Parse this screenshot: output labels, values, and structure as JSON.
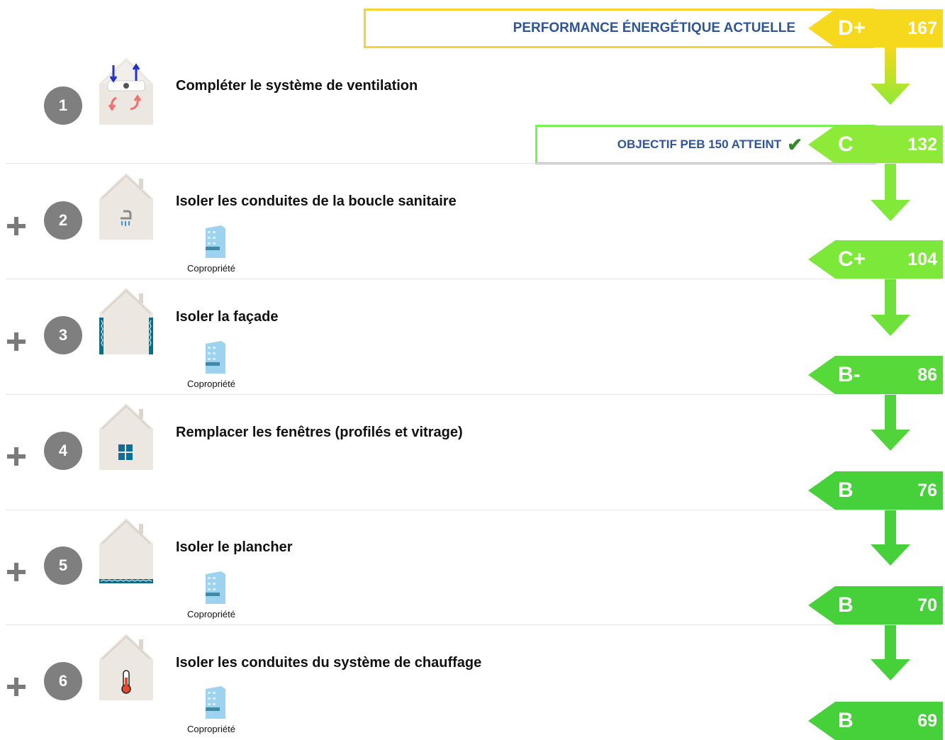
{
  "header": {
    "current_title": "PERFORMANCE ÉNERGÉTIQUE ACTUELLE",
    "target_title": "OBJECTIF PEB 150 ATTEINT",
    "target_check_icon": "checkmark-icon"
  },
  "colors": {
    "current_border": "#f5d330",
    "target_border": "#78f250",
    "title_blue": "#2f5597",
    "badge_grey": "#7f7f7f"
  },
  "labels": [
    {
      "class": "D+",
      "value": "167",
      "color": "#f6d81c"
    },
    {
      "class": "C",
      "value": "132",
      "color": "#8eea38"
    },
    {
      "class": "C+",
      "value": "104",
      "color": "#7ce83a"
    },
    {
      "class": "B-",
      "value": "86",
      "color": "#58d93a"
    },
    {
      "class": "B",
      "value": "76",
      "color": "#46d03a"
    },
    {
      "class": "B",
      "value": "70",
      "color": "#46d03a"
    },
    {
      "class": "B",
      "value": "69",
      "color": "#46d03a"
    }
  ],
  "steps": [
    {
      "number": "1",
      "title": "Compléter le système de ventilation",
      "icon": "ventilation-house-icon",
      "prefix": "",
      "copropriete": ""
    },
    {
      "number": "2",
      "title": "Isoler les conduites de la boucle sanitaire",
      "icon": "shower-house-icon",
      "prefix": "+",
      "copropriete": "Copropriété"
    },
    {
      "number": "3",
      "title": "Isoler la façade",
      "icon": "facade-insulation-house-icon",
      "prefix": "+",
      "copropriete": "Copropriété"
    },
    {
      "number": "4",
      "title": "Remplacer les fenêtres (profilés et vitrage)",
      "icon": "window-house-icon",
      "prefix": "+",
      "copropriete": ""
    },
    {
      "number": "5",
      "title": "Isoler le plancher",
      "icon": "floor-insulation-house-icon",
      "prefix": "+",
      "copropriete": "Copropriété"
    },
    {
      "number": "6",
      "title": "Isoler les conduites du système de chauffage",
      "icon": "thermometer-house-icon",
      "prefix": "+",
      "copropriete": "Copropriété"
    }
  ]
}
